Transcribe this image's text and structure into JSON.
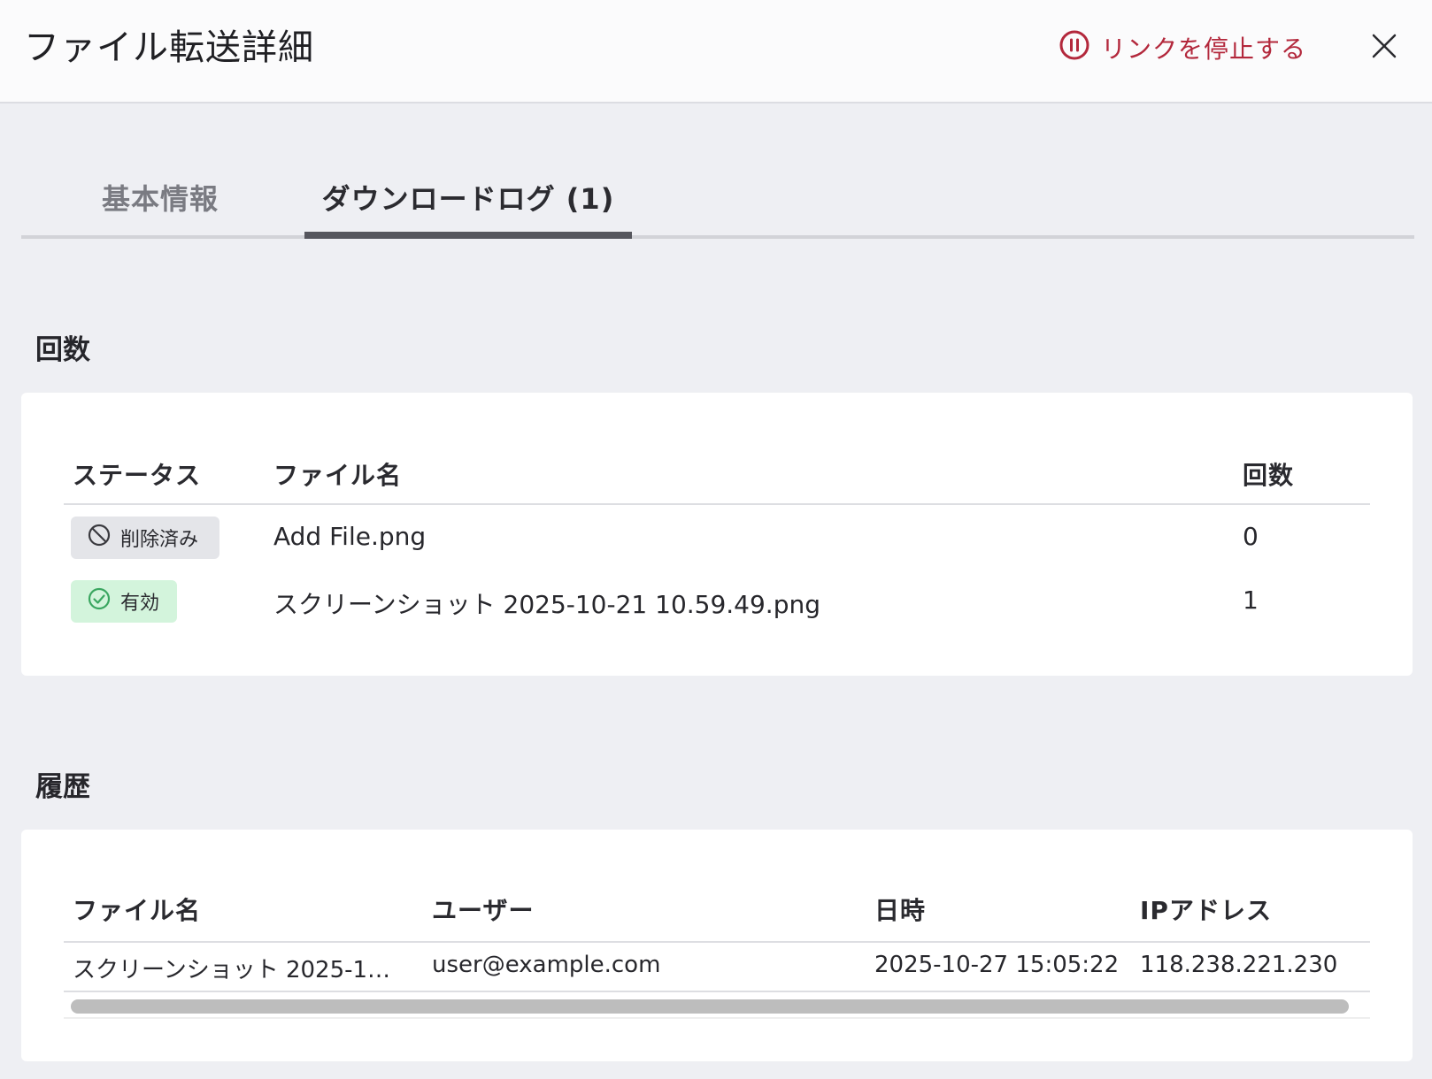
{
  "header": {
    "title": "ファイル転送詳細",
    "stop_link_label": "リンクを停止する",
    "stop_link_color": "#b3283c"
  },
  "tabs": [
    {
      "label": "基本情報",
      "active": false
    },
    {
      "label": "ダウンロードログ (1)",
      "active": true
    }
  ],
  "count_section": {
    "heading": "回数",
    "columns": [
      "ステータス",
      "ファイル名",
      "回数"
    ],
    "rows": [
      {
        "status": "削除済み",
        "status_icon": "prohibited-icon",
        "file_name": "Add File.png",
        "count": "0"
      },
      {
        "status": "有効",
        "status_icon": "check-circle-icon",
        "file_name": "スクリーンショット 2025-10-21 10.59.49.png",
        "count": "1"
      }
    ]
  },
  "history_section": {
    "heading": "履歴",
    "columns": [
      "ファイル名",
      "ユーザー",
      "日時",
      "IPアドレス"
    ],
    "rows": [
      {
        "file_name": "スクリーンショット 2025-1…",
        "user": "user@example.com",
        "datetime": "2025-10-27 15:05:22",
        "ip": "118.238.221.230"
      }
    ]
  },
  "colors": {
    "background": "#eeeff3",
    "deleted_badge": "#e4e5e9",
    "active_badge": "#d3f4dc",
    "active_icon": "#3aa660"
  }
}
